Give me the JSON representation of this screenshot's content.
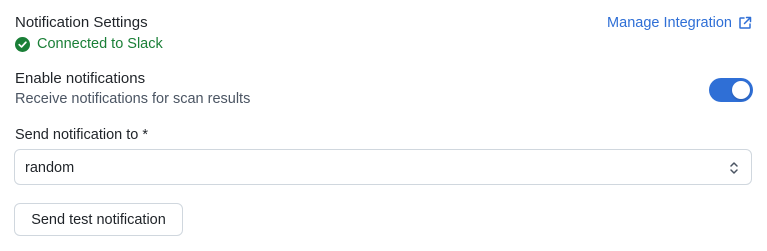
{
  "header": {
    "title": "Notification Settings",
    "status_text": "Connected to Slack",
    "status_icon": "check-circle-icon",
    "manage_link_label": "Manage Integration",
    "manage_link_icon": "external-link-icon"
  },
  "notifications": {
    "enable_label": "Enable notifications",
    "enable_description": "Receive notifications for scan results",
    "enabled": true
  },
  "channel_field": {
    "label": "Send notification to *",
    "value": "random"
  },
  "actions": {
    "test_button_label": "Send test notification"
  },
  "colors": {
    "accent": "#2f6fd6",
    "success": "#1a7f37",
    "border": "#d0d7de"
  }
}
